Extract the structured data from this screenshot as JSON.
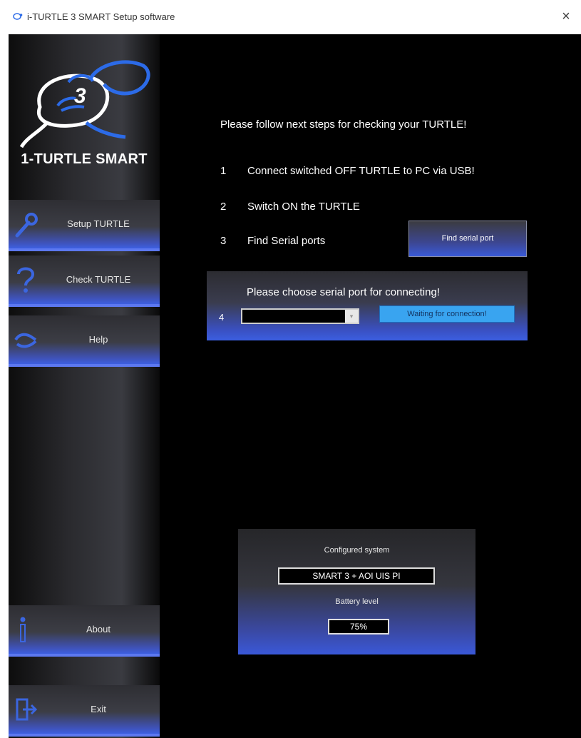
{
  "window": {
    "title": "i-TURTLE 3 SMART Setup software",
    "close_symbol": "×"
  },
  "brand": {
    "name": "1-TURTLE SMART",
    "logo_digit": "3"
  },
  "sidebar": {
    "items": [
      {
        "label": "Setup TURTLE",
        "icon": "wrench-icon"
      },
      {
        "label": "Check TURTLE",
        "icon": "question-icon"
      },
      {
        "label": "Help",
        "icon": "handshake-icon"
      },
      {
        "label": "About",
        "icon": "info-icon"
      },
      {
        "label": "Exit",
        "icon": "exit-door-icon"
      }
    ]
  },
  "main": {
    "heading": "Please follow next steps for checking your TURTLE!",
    "steps": [
      {
        "num": "1",
        "text": "Connect switched OFF TURTLE to PC via USB!"
      },
      {
        "num": "2",
        "text": "Switch ON the TURTLE"
      },
      {
        "num": "3",
        "text": "Find Serial ports"
      }
    ],
    "find_button": "Find serial port",
    "port": {
      "prompt": "Please choose serial port for connecting!",
      "num": "4",
      "selected_value": "",
      "dropdown_arrow": "▾",
      "status": "Waiting for connection!"
    }
  },
  "config": {
    "system_label": "Configured system",
    "system_value": "SMART 3 + AOI UIS PI",
    "battery_label": "Battery level",
    "battery_value": "75%"
  },
  "colors": {
    "accent_blue": "#3b5ee0",
    "status_blue": "#39a4f0",
    "logo_blue": "#2c6be8"
  }
}
